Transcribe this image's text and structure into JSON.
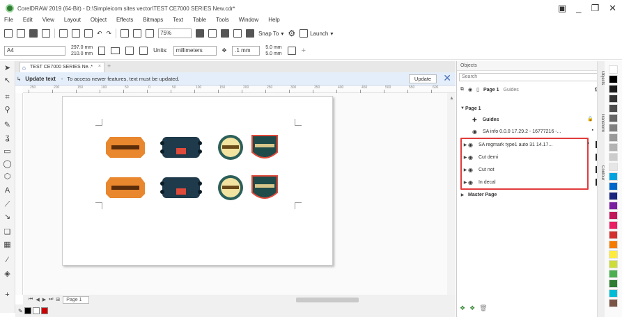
{
  "window": {
    "title": "CorelDRAW 2019 (64-Bit) - D:\\Simpleicom sites vector\\TEST CE7000 SERIES New.cdr*",
    "controls": [
      "▣",
      "_",
      "❐",
      "✕"
    ]
  },
  "menu": [
    "File",
    "Edit",
    "View",
    "Layout",
    "Object",
    "Effects",
    "Bitmaps",
    "Text",
    "Table",
    "Tools",
    "Window",
    "Help"
  ],
  "toolbar": {
    "zoom": "75%",
    "snap_to": "Snap To",
    "launch": "Launch"
  },
  "property_bar": {
    "paper_size": "A4",
    "width": "297.0 mm",
    "height": "210.0 mm",
    "units_label": "Units:",
    "units_value": "millimeters",
    "nudge": ".1 mm",
    "dup_x": "5.0 mm",
    "dup_y": "5.0 mm"
  },
  "document_tab": {
    "label": "TEST CE7000 SERIES Ne..*"
  },
  "infobar": {
    "title": "Update text",
    "message": "To access newer features, text must be updated.",
    "update_button": "Update"
  },
  "ruler": {
    "ticks": [
      "250",
      "200",
      "150",
      "100",
      "50",
      "0",
      "50",
      "100",
      "150",
      "200",
      "250",
      "300",
      "350",
      "400",
      "450",
      "500",
      "550",
      "600"
    ],
    "unit": "millimeters"
  },
  "bottom": {
    "page_tab": "Page 1"
  },
  "objects_docker": {
    "title": "Objects",
    "search_placeholder": "Search",
    "page_header": "Page 1",
    "guides_header": "Guides",
    "tree": [
      {
        "label": "Page 1",
        "level": 0
      },
      {
        "label": "Guides",
        "level": 1
      },
      {
        "label": "SA info 0.0.0 17.29.2 - 16777216 -...",
        "level": 1
      },
      {
        "label": "SA regmark type1 auto 31 14.17...",
        "level": 1
      },
      {
        "label": "Cut demi",
        "level": 1
      },
      {
        "label": "Cut not",
        "level": 1
      },
      {
        "label": "In decal",
        "level": 1
      },
      {
        "label": "Master Page",
        "level": 0
      }
    ],
    "side_tabs": [
      "Objects",
      "Transform",
      "Contour"
    ]
  },
  "palette_colors": [
    "#ffffff",
    "#000000",
    "#1a1a1a",
    "#333333",
    "#4d4d4d",
    "#666666",
    "#808080",
    "#999999",
    "#b3b3b3",
    "#cccccc",
    "#e6e6e6",
    "#00a3e0",
    "#0066cc",
    "#1a237e",
    "#7b1fa2",
    "#c2185b",
    "#e91e63",
    "#d32f2f",
    "#f57c00",
    "#ffeb3b",
    "#cddc39",
    "#4caf50",
    "#2e7d32",
    "#00bcd4",
    "#795548"
  ],
  "status_swatches": [
    "#000000",
    "#ffffff",
    "#cc0000"
  ]
}
